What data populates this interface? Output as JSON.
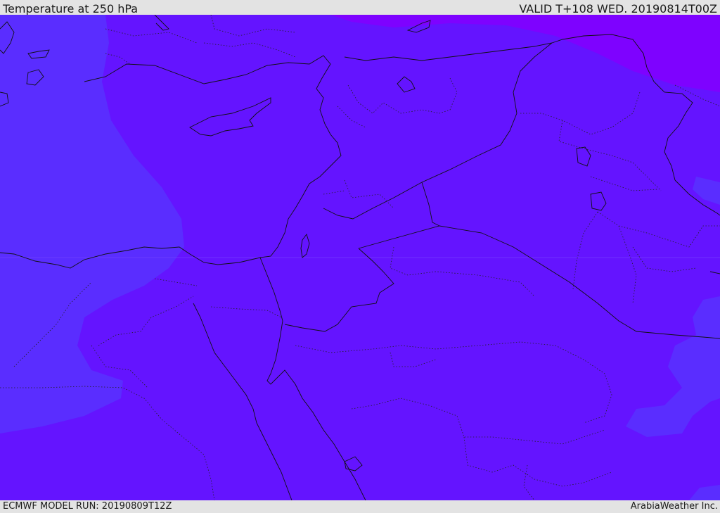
{
  "header": {
    "title": "Temperature at 250 hPa",
    "valid_time": "VALID T+108 WED. 20190814T00Z"
  },
  "footer": {
    "model_run": "ECMWF MODEL RUN: 20190809T12Z",
    "credit": "ArabiaWeather Inc."
  },
  "map": {
    "field": "Temperature",
    "level": "250 hPa",
    "colors": {
      "base": "#6414ff",
      "cooler_west": "#5a2dff",
      "warmer_northeast": "#7e02ff",
      "coastline": "#111111",
      "border": "#111111"
    }
  }
}
